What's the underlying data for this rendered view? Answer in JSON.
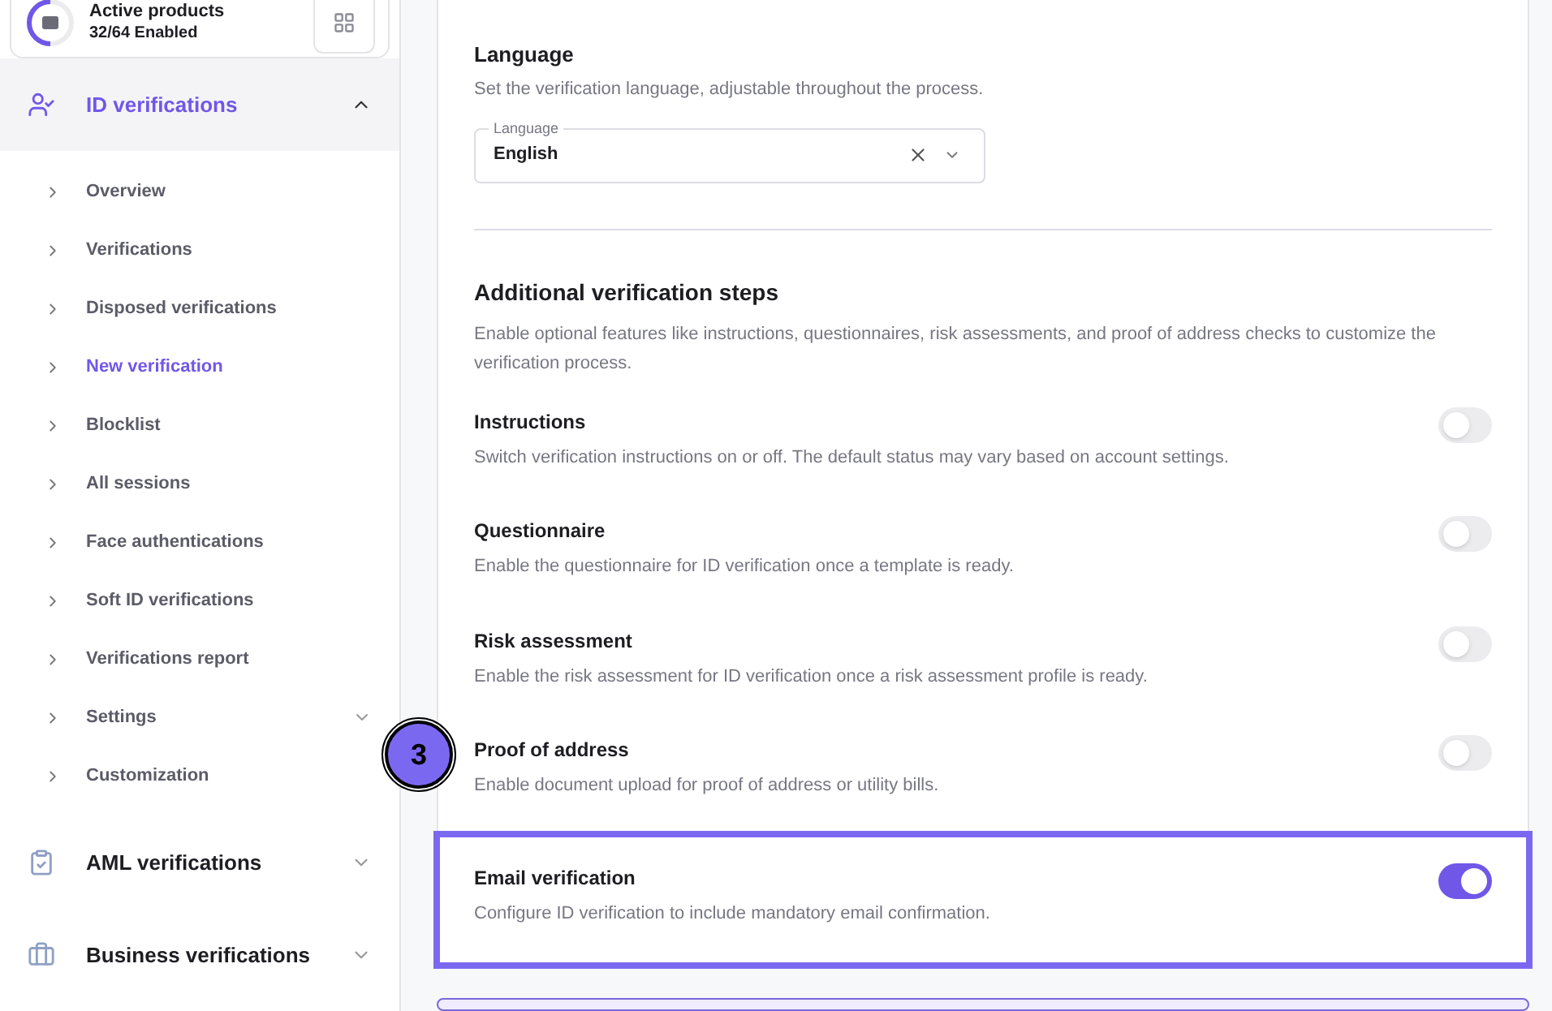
{
  "products_card": {
    "title": "Active products",
    "subtitle": "32/64 Enabled",
    "level": 0.5
  },
  "sidebar": {
    "sections": [
      {
        "label": "ID verifications",
        "selected": true,
        "expanded": true,
        "children": [
          {
            "label": "Overview",
            "selected": false,
            "has_submenu": false
          },
          {
            "label": "Verifications",
            "selected": false,
            "has_submenu": false
          },
          {
            "label": "Disposed verifications",
            "selected": false,
            "has_submenu": false
          },
          {
            "label": "New verification",
            "selected": true,
            "has_submenu": false
          },
          {
            "label": "Blocklist",
            "selected": false,
            "has_submenu": false
          },
          {
            "label": "All sessions",
            "selected": false,
            "has_submenu": false
          },
          {
            "label": "Face authentications",
            "selected": false,
            "has_submenu": false
          },
          {
            "label": "Soft ID verifications",
            "selected": false,
            "has_submenu": false
          },
          {
            "label": "Verifications report",
            "selected": false,
            "has_submenu": false
          },
          {
            "label": "Settings",
            "selected": false,
            "has_submenu": true
          },
          {
            "label": "Customization",
            "selected": false,
            "has_submenu": false
          }
        ]
      },
      {
        "label": "AML verifications",
        "selected": false,
        "expanded": false
      },
      {
        "label": "Business verifications",
        "selected": false,
        "expanded": false
      }
    ]
  },
  "language": {
    "title": "Language",
    "description": "Set the verification language, adjustable throughout the process.",
    "field_label": "Language",
    "value": "English"
  },
  "additional_steps": {
    "title": "Additional verification steps",
    "description": "Enable optional features like instructions, questionnaires, risk assessments, and proof of address checks to customize the verification process.",
    "items": [
      {
        "title": "Instructions",
        "description": "Switch verification instructions on or off. The default status may vary based on account settings.",
        "on": false,
        "highlighted": false
      },
      {
        "title": "Questionnaire",
        "description": "Enable the questionnaire for ID verification once a template is ready.",
        "on": false,
        "highlighted": false
      },
      {
        "title": "Risk assessment",
        "description": "Enable the risk assessment for ID verification once a risk assessment profile is ready.",
        "on": false,
        "highlighted": false
      },
      {
        "title": "Proof of address",
        "description": "Enable document upload for proof of address or utility bills.",
        "on": false,
        "highlighted": false,
        "annotation": "3"
      },
      {
        "title": "Email verification",
        "description": "Configure ID verification to include mandatory email confirmation.",
        "on": true,
        "highlighted": true
      }
    ]
  }
}
